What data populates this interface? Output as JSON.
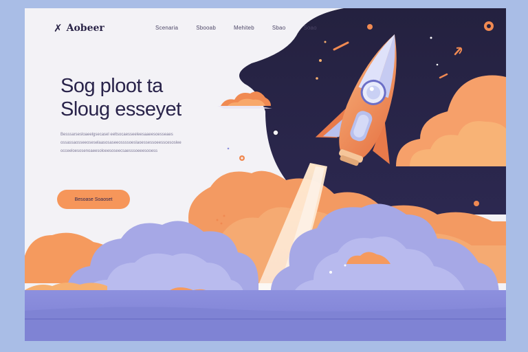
{
  "brand": {
    "name": "Aobeer",
    "logo_icon": "rocket-logo-icon"
  },
  "nav": {
    "items": [
      {
        "label": "Scenaria"
      },
      {
        "label": "Sbooab"
      },
      {
        "label": "Mehiteb"
      },
      {
        "label": "Sbao"
      },
      {
        "label": "Soao"
      }
    ]
  },
  "hero": {
    "title_line1": "Sog ploot ta",
    "title_line2": "Sloug esseyet",
    "body": "Besssarsesloaeelgsecasel eeltsocaesseeleesaaeesoesseaes ossassaosseeoseselaasosaseeossssoeslaoessessoeesscesoslee occeeloesosenoaeesoloeesoseecsaesssoeeesooess",
    "cta_label": "Besoase  Soaoset"
  },
  "colors": {
    "background": "#a9bde6",
    "page": "#f3f2f6",
    "night_sky": "#24213f",
    "accent_orange": "#f6965a",
    "cloud_lavender": "#a6a8e6",
    "text_dark": "#29234a"
  }
}
